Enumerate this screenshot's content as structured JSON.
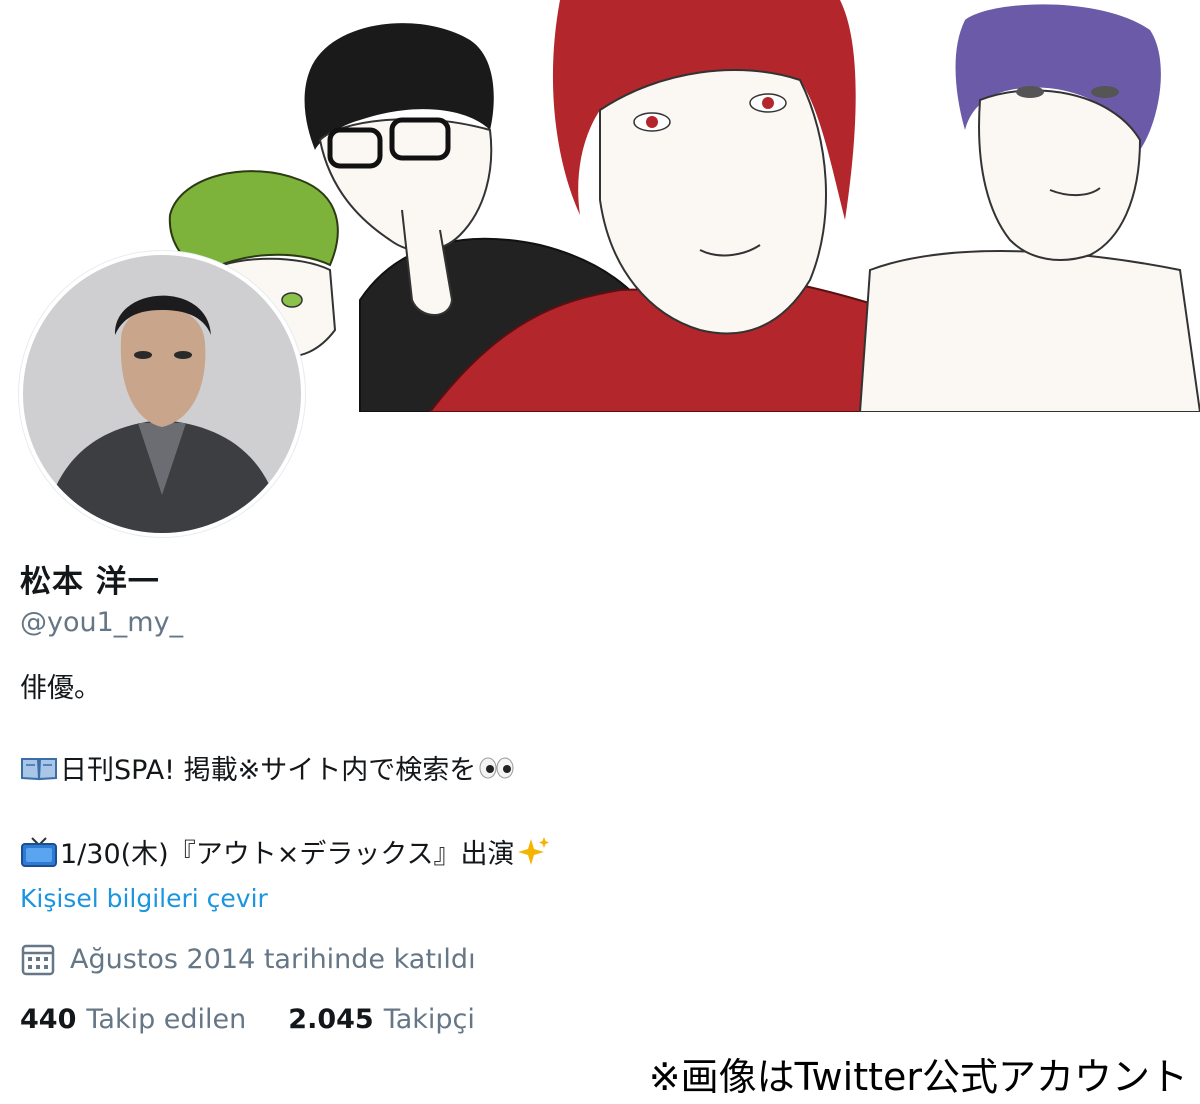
{
  "profile": {
    "display_name": "松本 洋一",
    "handle": "@you1_my_",
    "bio_line1": "俳優。",
    "bio_line2": "日刊SPA! 掲載※サイト内で検索を",
    "bio_line2_icon": "open-book-emoji",
    "bio_line2_trailing_icon": "eyes-emoji",
    "bio_line3": "1/30(木)『アウト×デラックス』出演",
    "bio_line3_icon": "tv-emoji",
    "bio_line3_trailing_icon": "sparkles-emoji",
    "translate_link": "Kişisel bilgileri çevir",
    "joined_icon": "calendar-icon",
    "joined": "Ağustos 2014 tarihinde katıldı"
  },
  "stats": {
    "following_count": "440",
    "following_label": "Takip edilen",
    "followers_count": "2.045",
    "followers_label": "Takipçi"
  },
  "caption": "※画像はTwitter公式アカウント",
  "colors": {
    "link": "#1b95e0",
    "secondary_text": "#657786",
    "primary_text": "#14171a",
    "banner_red": "#b3262b",
    "banner_green": "#7db33a",
    "banner_purple": "#6a5aa8"
  }
}
